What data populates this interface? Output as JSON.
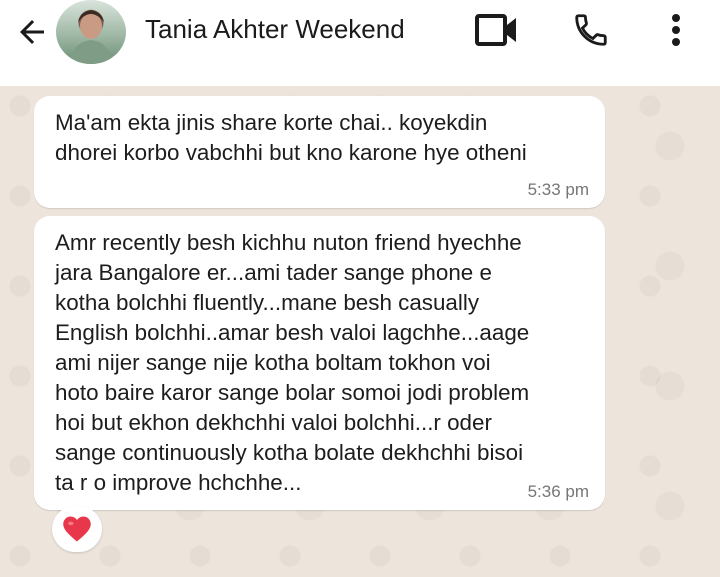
{
  "header": {
    "contact_name": "Tania Akhter Weekend",
    "back_icon": "arrow-left-icon",
    "video_icon": "video-camera-icon",
    "call_icon": "phone-icon",
    "menu_icon": "more-vertical-icon"
  },
  "messages": [
    {
      "text": "Ma'am ekta jinis share korte chai.. koyekdin\ndhorei korbo vabchhi but kno karone hye otheni",
      "time": "5:33 pm"
    },
    {
      "text": "Amr recently besh kichhu nuton friend hyechhe\njara Bangalore er...ami tader sange phone e\nkotha bolchhi fluently...mane besh casually\nEnglish bolchhi..amar besh valoi lagchhe...aage\nami nijer sange nije kotha boltam tokhon voi\nhoto baire karor sange bolar somoi jodi problem\nhoi but ekhon dekhchhi valoi bolchhi...r oder\nsange continuously kotha bolate dekhchhi bisoi\nta r o improve hchchhe...",
      "time": "5:36 pm",
      "reaction": "heart-emoji"
    }
  ],
  "colors": {
    "bubble": "#ffffff",
    "wallpaper": "#ede5dc",
    "heart": "#e8374a"
  }
}
